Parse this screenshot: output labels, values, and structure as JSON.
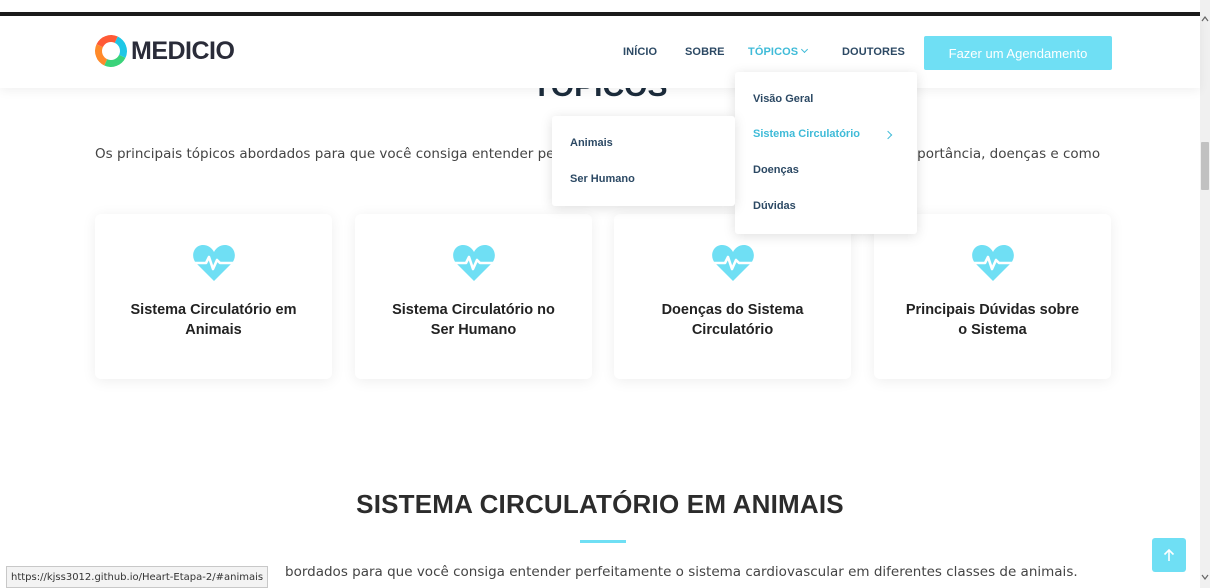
{
  "header": {
    "logo_text": "MEDICIO",
    "nav": {
      "inicio": "INÍCIO",
      "sobre": "SOBRE",
      "topicos": "TÓPICOS",
      "doutores": "DOUTORES"
    },
    "cta_label": "Fazer um Agendamento"
  },
  "dropdown": {
    "items": [
      "Visão Geral",
      "Sistema Circulatório",
      "Doenças",
      "Dúvidas"
    ],
    "active_item": "Sistema Circulatório",
    "submenu": [
      "Animais",
      "Ser Humano"
    ]
  },
  "topicos_section": {
    "title": "TÓPICOS",
    "intro_left": "Os principais tópicos abordados para que você consiga entender pe",
    "intro_right": "mportância, doenças e como"
  },
  "cards": [
    {
      "line1": "Sistema Circulatório em",
      "line2": "Animais",
      "icon": "heart-pulse-icon"
    },
    {
      "line1": "Sistema Circulatório no",
      "line2": "Ser Humano",
      "icon": "heart-pulse-icon"
    },
    {
      "line1": "Doenças do Sistema",
      "line2": "Circulatório",
      "icon": "heart-pulse-icon"
    },
    {
      "line1": "Principais Dúvidas sobre",
      "line2": "o Sistema",
      "icon": "heart-pulse-icon"
    }
  ],
  "animais_section": {
    "title": "SISTEMA CIRCULATÓRIO EM ANIMAIS",
    "intro": "bordados para que você consiga entender perfeitamente o sistema cardiovascular em diferentes classes de animais."
  },
  "status_bar": {
    "url": "https://kjss3012.github.io/Heart-Etapa-2/#animais"
  },
  "colors": {
    "accent": "#6fdff4",
    "nav_text": "#2c4964",
    "active": "#3fbbd8"
  }
}
